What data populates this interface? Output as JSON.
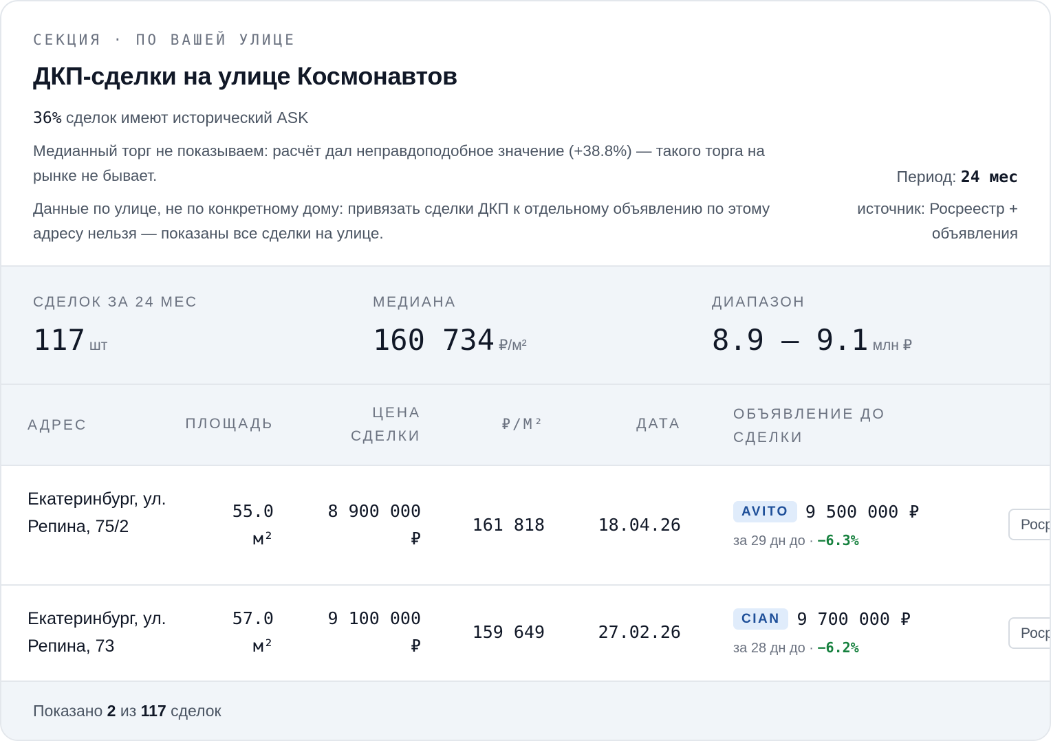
{
  "section": {
    "eyebrow": "СЕКЦИЯ · ПО ВАШЕЙ УЛИЦЕ",
    "title": "ДКП-сделки на улице Космонавтов",
    "ask_share_value": "36%",
    "ask_share_text": " сделок имеют исторический ASK",
    "note_bargain": "Медианный торг не показываем: расчёт дал неправдоподобное значение (+38.8%) — такого торга на рынке не бывает.",
    "note_street": "Данные по улице, не по конкретному дому: привязать сделки ДКП к отдельному объявлению по этому адресу нельзя — показаны все сделки на улице.",
    "period_label": "Период: ",
    "period_value": "24 мес",
    "source_text": "источник: Росреестр + объявления"
  },
  "stats": {
    "deals_label": "СДЕЛОК ЗА 24 МЕС",
    "deals_value": "117",
    "deals_unit": "шт",
    "median_label": "МЕДИАНА",
    "median_value": "160 734",
    "median_unit": "₽/м²",
    "range_label": "ДИАПАЗОН",
    "range_value": "8.9 — 9.1",
    "range_unit": "млн ₽"
  },
  "table": {
    "headers": {
      "address": "АДРЕС",
      "area": "ПЛОЩАДЬ",
      "price_line1": "ЦЕНА",
      "price_line2": "СДЕЛКИ",
      "ppm": "₽/М²",
      "date": "ДАТА",
      "listing_line1": "ОБЪЯВЛЕНИЕ ДО",
      "listing_line2": "СДЕЛКИ"
    },
    "rows": [
      {
        "address": "Екатеринбург, ул. Репина, 75/2",
        "area": "55.0",
        "area_unit": "м²",
        "price": "8 900 000",
        "price_unit": "₽",
        "ppm": "161 818",
        "date": "18.04.26",
        "listing_source": "AVITO",
        "listing_price": "9 500 000 ₽",
        "listing_days": "за 29 дн до · ",
        "listing_delta": "−6.3%",
        "source_button": "Росреестр"
      },
      {
        "address": "Екатеринбург, ул. Репина, 73",
        "area": "57.0",
        "area_unit": "м²",
        "price": "9 100 000",
        "price_unit": "₽",
        "ppm": "159 649",
        "date": "27.02.26",
        "listing_source": "CIAN",
        "listing_price": "9 700 000 ₽",
        "listing_days": "за 28 дн до · ",
        "listing_delta": "−6.2%",
        "source_button": "Росреестр"
      }
    ]
  },
  "footer": {
    "shown_prefix": "Показано ",
    "shown_count": "2",
    "shown_mid": " из ",
    "total_count": "117",
    "shown_suffix": " сделок"
  }
}
